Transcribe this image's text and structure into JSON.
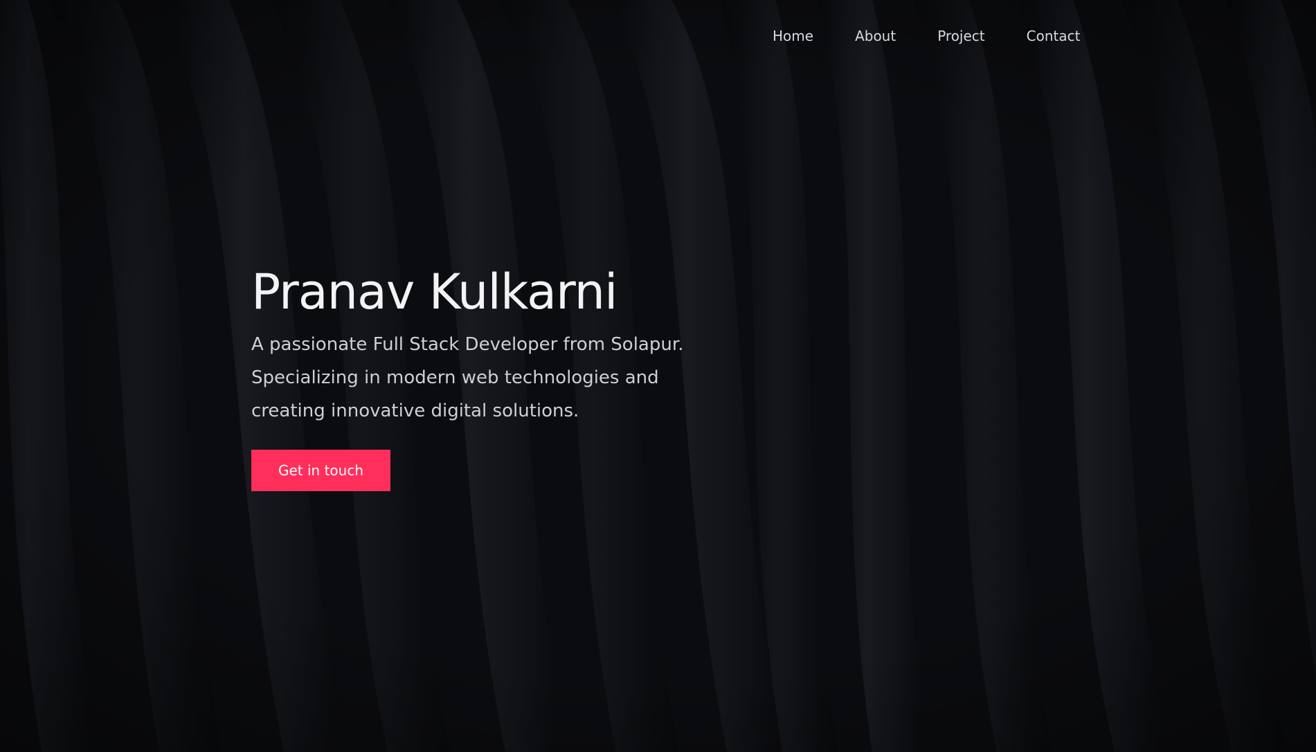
{
  "colors": {
    "background": "#0b0c0f",
    "accent": "#ff2e5b",
    "text_primary": "#f3f3f6",
    "text_secondary": "#cfcfd6"
  },
  "nav": {
    "items": [
      {
        "label": "Home"
      },
      {
        "label": "About"
      },
      {
        "label": "Project"
      },
      {
        "label": "Contact"
      }
    ]
  },
  "hero": {
    "title": "Pranav Kulkarni",
    "description": "A passionate Full Stack Developer from Solapur. Specializing in modern web technologies and creating innovative digital solutions.",
    "cta_label": "Get in touch"
  }
}
